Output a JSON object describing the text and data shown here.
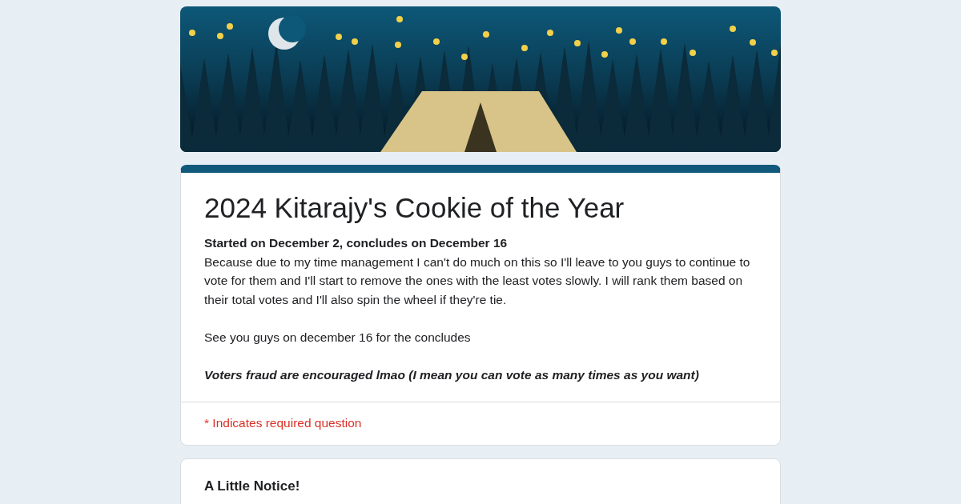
{
  "form": {
    "title": "2024 Kitarajy's Cookie of the Year",
    "description": [
      {
        "kind": "bold",
        "text": "Started on December 2, concludes on December 16"
      },
      {
        "kind": "plain",
        "text": "Because due to my time management I can't do much on this so I'll leave to you guys to continue to vote for them and I'll start to remove the ones with the least votes slowly. I will rank them based on their total votes and I'll also spin the wheel if they're tie."
      },
      {
        "kind": "gap",
        "text": "See you guys on december 16 for the concludes"
      },
      {
        "kind": "bold-italic",
        "text": "Voters fraud are encouraged lmao (I mean you can vote as many times as you want)"
      }
    ],
    "required_note": "* Indicates required question"
  },
  "sections": [
    {
      "title": "A Little Notice!"
    }
  ]
}
